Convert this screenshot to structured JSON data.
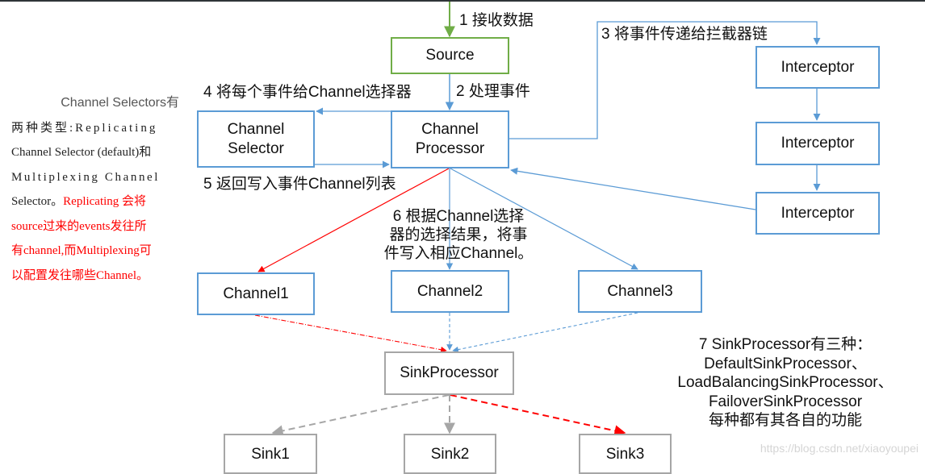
{
  "colors": {
    "blue": "#5b9bd5",
    "green": "#70ad47",
    "gray": "#a6a6a6",
    "red": "#ff0000",
    "text": "#111111"
  },
  "nodes": {
    "source": "Source",
    "channel_selector": [
      "Channel",
      "Selector"
    ],
    "channel_processor": [
      "Channel",
      "Processor"
    ],
    "interceptors": [
      "Interceptor",
      "Interceptor",
      "Interceptor"
    ],
    "channels": [
      "Channel1",
      "Channel2",
      "Channel3"
    ],
    "sink_processor": "SinkProcessor",
    "sinks": [
      "Sink1",
      "Sink2",
      "Sink3"
    ]
  },
  "steps": {
    "step1": "1 接收数据",
    "step2": "2 处理事件",
    "step3": "3 将事件传递给拦截器链",
    "step4": "4 将每个事件给Channel选择器",
    "step5": "5 返回写入事件Channel列表",
    "step6": [
      "6 根据Channel选择",
      "器的选择结果，将事",
      "件写入相应Channel。"
    ],
    "step7": [
      "7 SinkProcessor有三种：",
      "DefaultSinkProcessor、",
      "LoadBalancingSinkProcessor、",
      "FailoverSinkProcessor",
      "每种都有其各自的功能"
    ]
  },
  "side_note": {
    "line1": "Channel Selectors有",
    "line2": "两种类型:Replicating",
    "line3": "Channel Selector (default)和",
    "line4": "Multiplexing Channel",
    "line5_black": "Selector。",
    "line5_red": "Replicating 会将",
    "line6": "source过来的events发往所",
    "line7": "有channel,而Multiplexing可",
    "line8": "以配置发往哪些Channel。"
  },
  "watermark": "https://blog.csdn.net/xiaoyoupei"
}
